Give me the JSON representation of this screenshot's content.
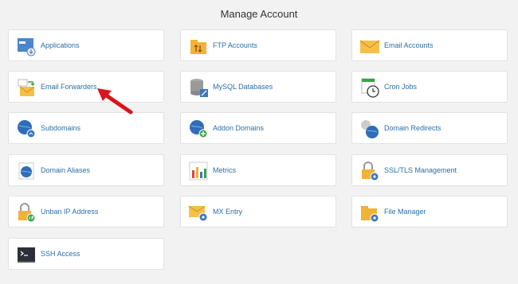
{
  "title": "Manage Account",
  "items": [
    {
      "label": "Applications",
      "icon": "applications-icon"
    },
    {
      "label": "FTP Accounts",
      "icon": "ftp-accounts-icon"
    },
    {
      "label": "Email Accounts",
      "icon": "email-accounts-icon"
    },
    {
      "label": "Email Forwarders",
      "icon": "email-forwarders-icon"
    },
    {
      "label": "MySQL Databases",
      "icon": "mysql-databases-icon"
    },
    {
      "label": "Cron Jobs",
      "icon": "cron-jobs-icon"
    },
    {
      "label": "Subdomains",
      "icon": "subdomains-icon"
    },
    {
      "label": "Addon Domains",
      "icon": "addon-domains-icon"
    },
    {
      "label": "Domain Redirects",
      "icon": "domain-redirects-icon"
    },
    {
      "label": "Domain Aliases",
      "icon": "domain-aliases-icon"
    },
    {
      "label": "Metrics",
      "icon": "metrics-icon"
    },
    {
      "label": "SSL/TLS Management",
      "icon": "ssl-tls-icon"
    },
    {
      "label": "Unban IP Address",
      "icon": "unban-ip-icon"
    },
    {
      "label": "MX Entry",
      "icon": "mx-entry-icon"
    },
    {
      "label": "File Manager",
      "icon": "file-manager-icon"
    },
    {
      "label": "SSH Access",
      "icon": "ssh-access-icon"
    }
  ],
  "colors": {
    "link": "#2c6ea6",
    "background": "#f2f2f2",
    "annotation_arrow": "#d9141b"
  }
}
